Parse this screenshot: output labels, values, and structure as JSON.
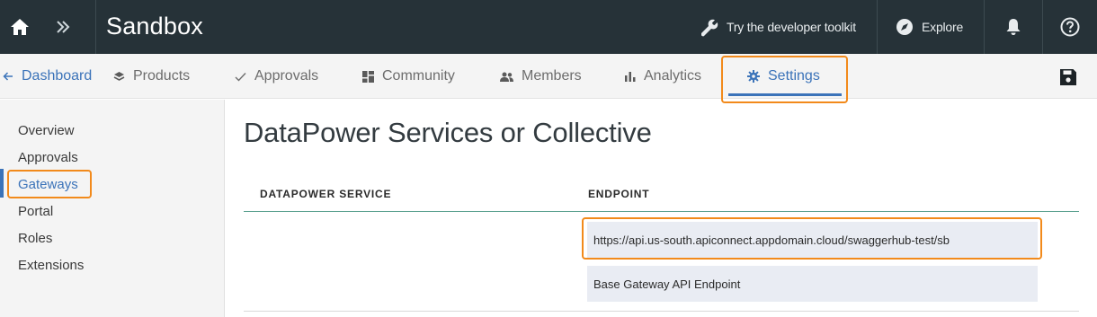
{
  "topbar": {
    "title": "Sandbox",
    "toolkit_label": "Try the developer toolkit",
    "explore_label": "Explore",
    "background": "#263238"
  },
  "tabs": {
    "back_label": "Dashboard",
    "items": [
      {
        "label": "Products",
        "icon": "layers-icon"
      },
      {
        "label": "Approvals",
        "icon": "check-icon"
      },
      {
        "label": "Community",
        "icon": "grid-icon"
      },
      {
        "label": "Members",
        "icon": "people-icon"
      },
      {
        "label": "Analytics",
        "icon": "bar-chart-icon"
      },
      {
        "label": "Settings",
        "icon": "gear-icon"
      }
    ],
    "active": "Settings",
    "accent": "#3b73b9"
  },
  "sidebar": {
    "items": [
      {
        "label": "Overview"
      },
      {
        "label": "Approvals"
      },
      {
        "label": "Gateways"
      },
      {
        "label": "Portal"
      },
      {
        "label": "Roles"
      },
      {
        "label": "Extensions"
      }
    ],
    "active": "Gateways"
  },
  "main": {
    "title": "DataPower Services or Collective",
    "table": {
      "headers": [
        "DATAPOWER SERVICE",
        "ENDPOINT"
      ],
      "rows": [
        {
          "service": "",
          "endpoint": "https://api.us-south.apiconnect.appdomain.cloud/swaggerhub-test/sb",
          "endpoint_description": "Base Gateway API Endpoint"
        }
      ]
    }
  },
  "highlight_color": "#f28a1b"
}
